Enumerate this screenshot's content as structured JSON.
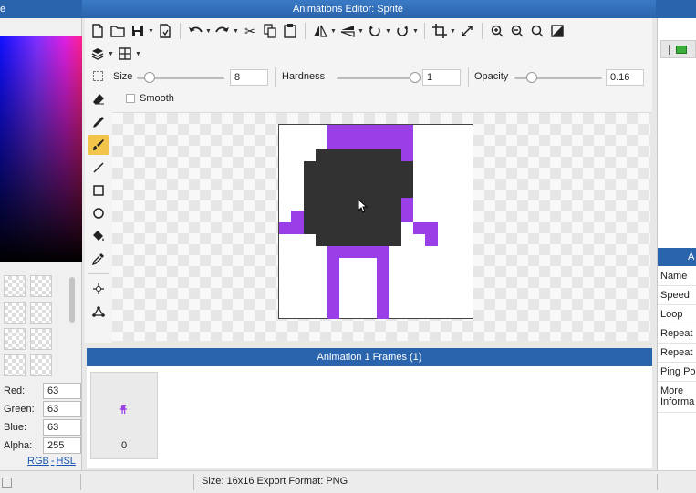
{
  "window": {
    "title": "Animations Editor: Sprite",
    "left_fragment": "e"
  },
  "color_panel": {
    "red_label": "Red:",
    "red": "63",
    "green_label": "Green:",
    "green": "63",
    "blue_label": "Blue:",
    "blue": "63",
    "alpha_label": "Alpha:",
    "alpha": "255",
    "rgb_link": "RGB",
    "link_sep": "-",
    "hsl_link": "HSL"
  },
  "toolbar": {
    "row1": [
      "new-file-icon",
      "open-folder-icon",
      "save-icon",
      "export-icon",
      "undo-icon",
      "redo-icon",
      "cut-icon",
      "copy-icon",
      "paste-icon",
      "flip-horizontal-icon",
      "flip-vertical-icon",
      "rotate-left-icon",
      "rotate-right-icon",
      "crop-icon",
      "resize-icon",
      "zoom-in-icon",
      "zoom-out-icon",
      "zoom-fit-icon",
      "invert-icon"
    ],
    "row2": [
      "layers-icon",
      "grid-icon"
    ]
  },
  "options": {
    "size_label": "Size",
    "size_value": "8",
    "size_level": 0.1,
    "hardness_label": "Hardness",
    "hardness_value": "1",
    "hardness_level": 1.0,
    "opacity_label": "Opacity",
    "opacity_value": "0.16",
    "opacity_level": 0.16,
    "smooth_label": "Smooth"
  },
  "tools": [
    "eraser-icon",
    "pencil-icon",
    "brush-icon",
    "line-icon",
    "rectangle-icon",
    "ellipse-icon",
    "fill-bucket-icon",
    "eyedropper-icon",
    "move-point-icon",
    "node-icon"
  ],
  "active_tool": "brush-icon",
  "sprite": {
    "colors": {
      "purple": "#9a3ee8",
      "dark": "#323232"
    }
  },
  "frames_panel": {
    "title": "Animation 1 Frames (1)",
    "frame_number": "0"
  },
  "properties_panel": {
    "header_fragment": "A",
    "rows": [
      "Name",
      "Speed",
      "Loop",
      "Repeat (",
      "Repeat",
      "Ping Po",
      "More Informa"
    ]
  },
  "status": {
    "text": "Size: 16x16   Export Format: PNG"
  }
}
